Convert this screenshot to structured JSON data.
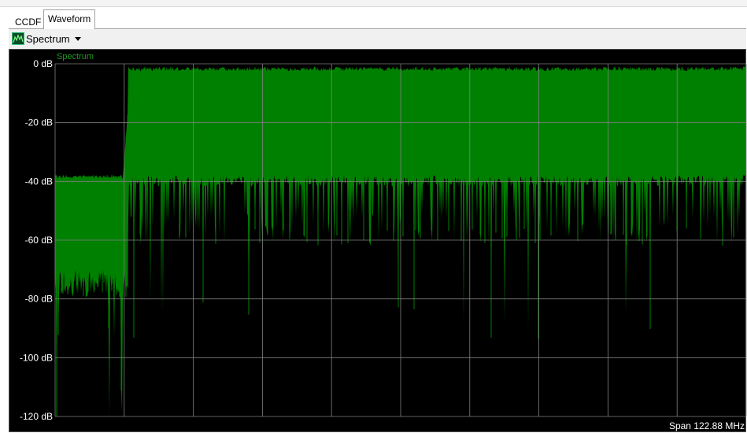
{
  "tabs": [
    {
      "label": "CCDF",
      "active": false
    },
    {
      "label": "Waveform",
      "active": true
    }
  ],
  "toolbar": {
    "view_label": "Spectrum",
    "view_icon": "spectrum-icon",
    "dropdown_icon": "chevron-down-icon"
  },
  "colors": {
    "plot_background": "#000000",
    "trace": "#008000",
    "grid": "#808080",
    "label": "#ffffff",
    "series_label": "#1a9a1a"
  },
  "chart_data": {
    "type": "area",
    "title": "",
    "series": [
      {
        "name": "Spectrum"
      }
    ],
    "ylim": [
      -120,
      0
    ],
    "y_ticks": [
      "0 dB",
      "-20 dB",
      "-40 dB",
      "-60 dB",
      "-80 dB",
      "-100 dB",
      "-120 dB"
    ],
    "y_unit": "dB",
    "x_divisions": 10,
    "span_label": "Span 122.88 MHz",
    "grid": true,
    "shape": {
      "x_range": [
        0,
        10
      ],
      "passband_start": 1.1,
      "passband_end": 10.0,
      "passband_top_db": -1,
      "passband_floor_db": -38,
      "passband_dip_db": -50,
      "shoulder_top_db": -39,
      "shoulder_floor_db": -70,
      "shoulder_dip_db": -90
    }
  }
}
